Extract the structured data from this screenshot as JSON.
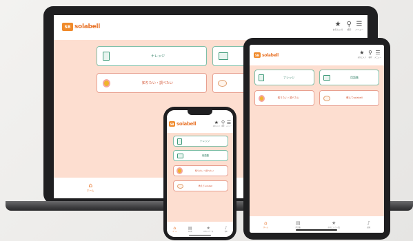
{
  "app": {
    "logo_prefix": "SB",
    "logo_text": "solabell",
    "colors": {
      "accent": "#e8742a",
      "background": "#fdded0",
      "green": "#3f9b7a",
      "red": "#d2502e"
    }
  },
  "header": {
    "icons": [
      {
        "name": "star-icon",
        "label": "お気に入り"
      },
      {
        "name": "search-icon",
        "label": "検索"
      },
      {
        "name": "menu-icon",
        "label": "メニュー"
      }
    ]
  },
  "cards": {
    "knowledge": "ナレッジ",
    "glossary": "用語集",
    "want_to_know": "知りたい・調べたい",
    "teach": "教えてsolabell"
  },
  "tabs": {
    "home": "ホーム",
    "glossary": "用語集",
    "favorites": "お気に入り一覧",
    "notifications": "通知"
  }
}
